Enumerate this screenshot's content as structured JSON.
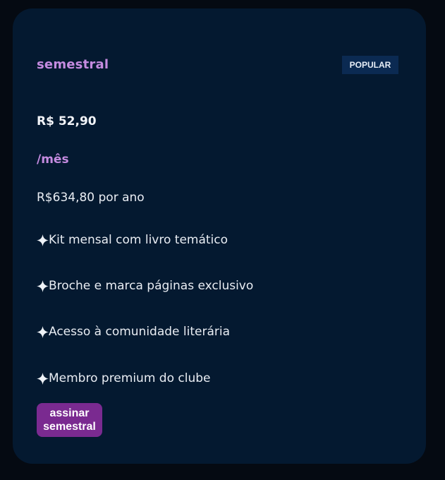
{
  "plan": {
    "name": "semestral",
    "badge": "POPULAR",
    "price": "R$ 52,90",
    "period": "/mês",
    "yearly": "R$634,80 por ano"
  },
  "features": [
    {
      "icon": "sparkle-icon",
      "label": "Kit mensal com livro temático"
    },
    {
      "icon": "sparkle-icon",
      "label": "Broche e marca páginas exclusivo"
    },
    {
      "icon": "sparkle-icon",
      "label": "Acesso à comunidade literária"
    },
    {
      "icon": "sparkle-icon",
      "label": "Membro premium do clube"
    }
  ],
  "cta": {
    "label": "assinar semestral"
  },
  "colors": {
    "background": "#050a12",
    "card": "#041930",
    "accent": "#c58be0",
    "badge_bg": "#0b2a52",
    "button": "#7a2a90"
  }
}
